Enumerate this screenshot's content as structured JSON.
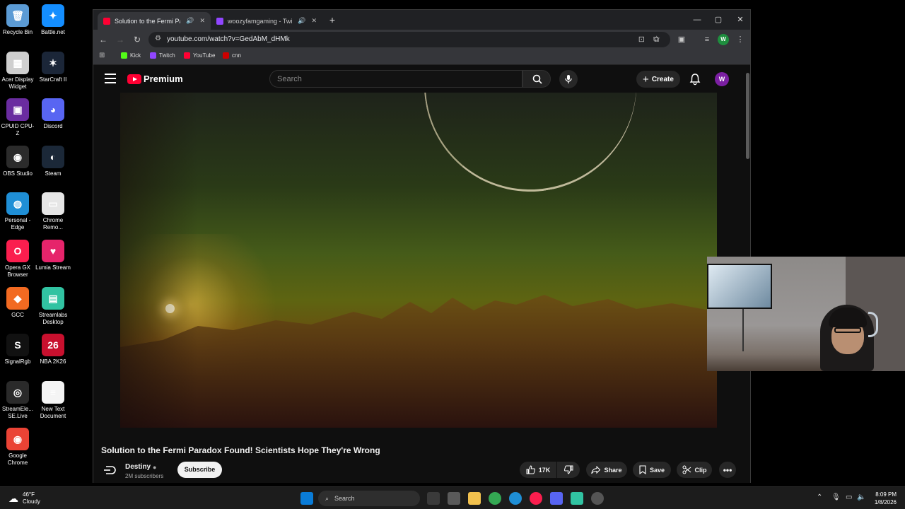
{
  "desktop": {
    "icons": [
      {
        "label": "Recycle Bin",
        "color": "#5b9bd5",
        "glyph": "🗑"
      },
      {
        "label": "Battle.net",
        "color": "#148eff",
        "glyph": "✦"
      },
      {
        "label": "Acer Display Widget",
        "color": "#cfcfcf",
        "glyph": "▦"
      },
      {
        "label": "StarCraft II",
        "color": "#1b2638",
        "glyph": "✶"
      },
      {
        "label": "CPUID CPU-Z",
        "color": "#6a2ca0",
        "glyph": "▣"
      },
      {
        "label": "Discord",
        "color": "#5865f2",
        "glyph": "◕"
      },
      {
        "label": "OBS Studio",
        "color": "#2b2b2b",
        "glyph": "◉"
      },
      {
        "label": "Steam",
        "color": "#1b2838",
        "glyph": "◐"
      },
      {
        "label": "Personal - Edge",
        "color": "#1f8fd6",
        "glyph": "◍"
      },
      {
        "label": "Chrome Remo...",
        "color": "#e6e6e6",
        "glyph": "▭"
      },
      {
        "label": "Opera GX Browser",
        "color": "#fa1e4e",
        "glyph": "O"
      },
      {
        "label": "Lumia Stream",
        "color": "#e6246b",
        "glyph": "♥"
      },
      {
        "label": "GCC",
        "color": "#f26a21",
        "glyph": "◆"
      },
      {
        "label": "Streamlabs Desktop",
        "color": "#31c3a2",
        "glyph": "▤"
      },
      {
        "label": "SignalRgb",
        "color": "#111111",
        "glyph": "S"
      },
      {
        "label": "NBA 2K26",
        "color": "#c8102e",
        "glyph": "26"
      },
      {
        "label": "StreamEle... SE.Live",
        "color": "#2a2a2a",
        "glyph": "◎"
      },
      {
        "label": "New Text Document",
        "color": "#f4f4f4",
        "glyph": "≡"
      },
      {
        "label": "Google Chrome",
        "color": "#ea4335",
        "glyph": "◉"
      }
    ]
  },
  "browser": {
    "tabs": [
      {
        "title": "Solution to the Fermi Parad",
        "favicon_color": "#ff0033",
        "active": true
      },
      {
        "title": "woozyfamgaming - Twitch",
        "favicon_color": "#9146ff",
        "active": false
      }
    ],
    "new_tab": "+",
    "url": "youtube.com/watch?v=GedAbM_dHMk",
    "bookmarks": [
      {
        "label": "Kick",
        "color": "#53fc18"
      },
      {
        "label": "Twitch",
        "color": "#9146ff"
      },
      {
        "label": "YouTube",
        "color": "#ff0033"
      },
      {
        "label": "cnn",
        "color": "#cc0000"
      }
    ],
    "profile_initial": "W"
  },
  "youtube": {
    "logo_text": "Premium",
    "search_placeholder": "Search",
    "create_label": "Create",
    "avatar_initial": "W",
    "video_title": "Solution to the Fermi Paradox Found! Scientists Hope They're Wrong",
    "channel_name": "Destiny",
    "subscribers": "2M subscribers",
    "subscribe_label": "Subscribe",
    "likes": "17K",
    "share_label": "Share",
    "save_label": "Save",
    "clip_label": "Clip"
  },
  "taskbar": {
    "temperature": "46°F",
    "condition": "Cloudy",
    "search_label": "Search",
    "time": "8:09 PM",
    "date": "1/8/2026"
  }
}
